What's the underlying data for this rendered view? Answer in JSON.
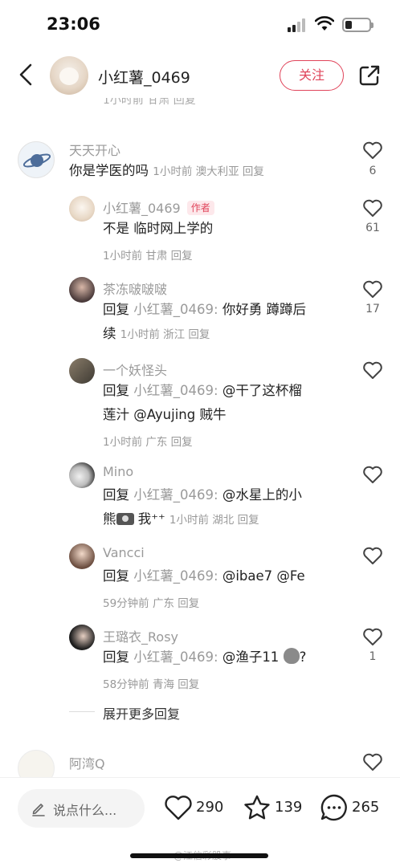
{
  "status_bar": {
    "time": "23:06"
  },
  "header": {
    "username": "小红薯_0469",
    "follow_label": "关注"
  },
  "top_cut_text": "1小时前 甘肃 回复",
  "comments": [
    {
      "name": "天天开心",
      "text": "你是学医的吗",
      "meta": "1小时前 澳大利亚 回复",
      "likes": "6"
    },
    {
      "name": "小红薯_0469",
      "badge": "作者",
      "text": "不是  临时网上学的",
      "meta": "1小时前 甘肃 回复",
      "likes": "61"
    },
    {
      "name": "茶冻啵啵啵",
      "reply_prefix": "回复",
      "reply_target": "小红薯_0469:",
      "text_line1": "你好勇   蹲蹲后",
      "text_line2": "续",
      "meta": "1小时前 浙江 回复",
      "likes": "17"
    },
    {
      "name": "一个妖怪头",
      "reply_prefix": "回复",
      "reply_target": "小红薯_0469:",
      "text_line1": "@干了这杯榴",
      "text_line2": "莲汁 @Ayujing 贼牛",
      "meta": "1小时前 广东 回复",
      "likes": ""
    },
    {
      "name": "Mino",
      "reply_prefix": "回复",
      "reply_target": "小红薯_0469:",
      "text_line1": "@水星上的小",
      "text_line2a": "熊",
      "text_line2b": "我⁺⁺",
      "meta": "1小时前 湖北 回复",
      "likes": ""
    },
    {
      "name": "Vancci",
      "reply_prefix": "回复",
      "reply_target": "小红薯_0469:",
      "text_line1": "@ibae7 @Fe",
      "meta": "59分钟前 广东 回复",
      "likes": ""
    },
    {
      "name": "王璐衣_Rosy",
      "reply_prefix": "回复",
      "reply_target": "小红薯_0469:",
      "text_line1": "@渔子11",
      "text_tail": "?",
      "meta": "58分钟前 青海 回复",
      "likes": "1"
    },
    {
      "name": "阿湾Q",
      "likes": ""
    }
  ],
  "expand_label": "展开更多回复",
  "bottom_bar": {
    "input_placeholder": "说点什么...",
    "likes": "290",
    "stars": "139",
    "comments": "265"
  },
  "watermark": "@江信彩股事",
  "colors": {
    "accent": "#e0445a",
    "muted": "#9a9a9a"
  }
}
